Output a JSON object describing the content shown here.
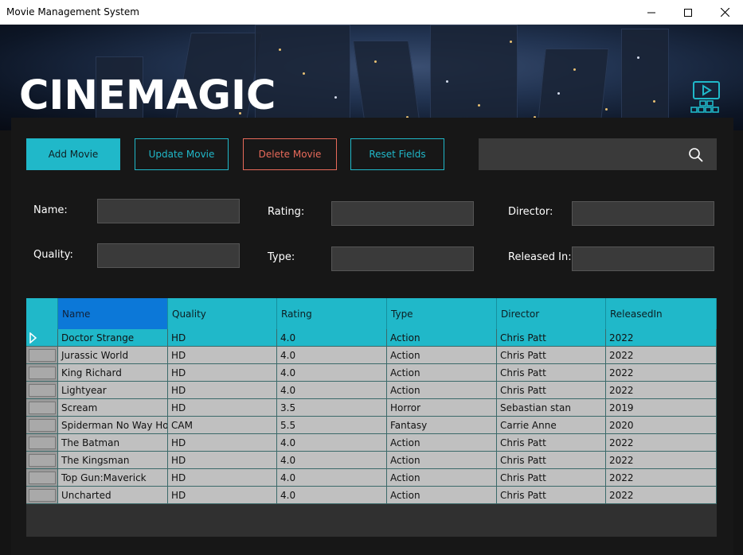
{
  "window": {
    "title": "Movie Management System"
  },
  "brand": {
    "name": "CINEMAGIC"
  },
  "toolbar": {
    "add_label": "Add Movie",
    "update_label": "Update Movie",
    "delete_label": "Delete Movie",
    "reset_label": "Reset Fields",
    "search_placeholder": ""
  },
  "form": {
    "name_label": "Name:",
    "rating_label": "Rating:",
    "director_label": "Director:",
    "quality_label": "Quality:",
    "type_label": "Type:",
    "released_label": "Released In:"
  },
  "colors": {
    "accent": "#20b8c9",
    "danger": "#e86a5a",
    "selected_header": "#0c78d8",
    "row_bg": "#c0c0c0"
  },
  "table": {
    "columns": [
      "Name",
      "Quality",
      "Rating",
      "Type",
      "Director",
      "ReleasedIn"
    ],
    "rows": [
      [
        "Doctor Strange",
        "HD",
        "4.0",
        "Action",
        "Chris Patt",
        "2022"
      ],
      [
        "Jurassic World",
        "HD",
        "4.0",
        "Action",
        "Chris Patt",
        "2022"
      ],
      [
        "King Richard",
        "HD",
        "4.0",
        "Action",
        "Chris Patt",
        "2022"
      ],
      [
        "Lightyear",
        "HD",
        "4.0",
        "Action",
        "Chris Patt",
        "2022"
      ],
      [
        "Scream",
        "HD",
        "3.5",
        "Horror",
        "Sebastian stan",
        "2019"
      ],
      [
        "Spiderman No Way Ho...",
        "CAM",
        "5.5",
        "Fantasy",
        "Carrie Anne",
        "2020"
      ],
      [
        "The Batman",
        "HD",
        "4.0",
        "Action",
        "Chris Patt",
        "2022"
      ],
      [
        "The Kingsman",
        "HD",
        "4.0",
        "Action",
        "Chris Patt",
        "2022"
      ],
      [
        "Top Gun:Maverick",
        "HD",
        "4.0",
        "Action",
        "Chris Patt",
        "2022"
      ],
      [
        "Uncharted",
        "HD",
        "4.0",
        "Action",
        "Chris Patt",
        "2022"
      ]
    ],
    "selected_row": 0
  }
}
